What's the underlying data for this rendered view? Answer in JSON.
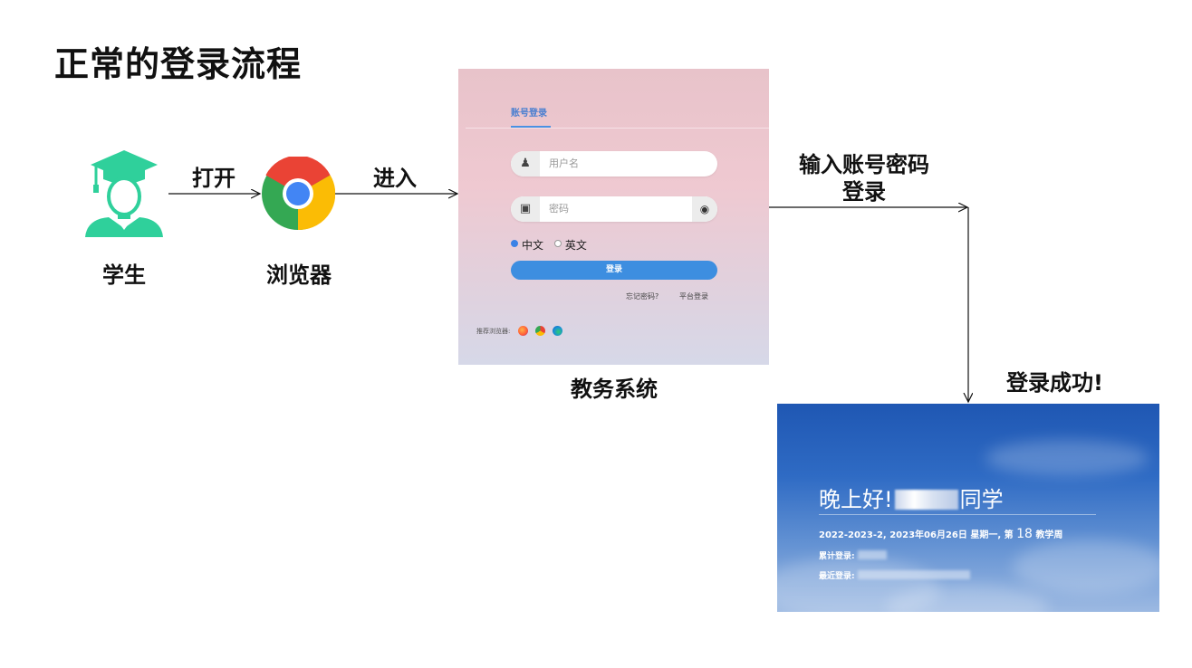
{
  "title": "正常的登录流程",
  "nodes": {
    "student": "学生",
    "browser": "浏览器",
    "system": "教务系统"
  },
  "edges": {
    "open": "打开",
    "enter": "进入",
    "input_line1": "输入账号密码",
    "input_line2": "登录",
    "success": "登录成功!"
  },
  "login_screen": {
    "tab": "账号登录",
    "username_placeholder": "用户名",
    "password_placeholder": "密码",
    "lang_options": [
      "中文",
      "英文"
    ],
    "login_button": "登录",
    "forgot_password": "忘记密码?",
    "platform_login": "平台登录",
    "recommended_browsers": "推荐浏览器:"
  },
  "success_screen": {
    "greeting_prefix": "晚上好!",
    "greeting_suffix": "同学",
    "date_prefix": "2022-2023-2, 2023年06月26日 星期一, 第",
    "week_number": "18",
    "date_suffix": "教学周",
    "total_logins": "累计登录:",
    "last_login": "最近登录:"
  },
  "colors": {
    "student_icon": "#2fd09b",
    "primary_blue": "#3d8ee0"
  }
}
